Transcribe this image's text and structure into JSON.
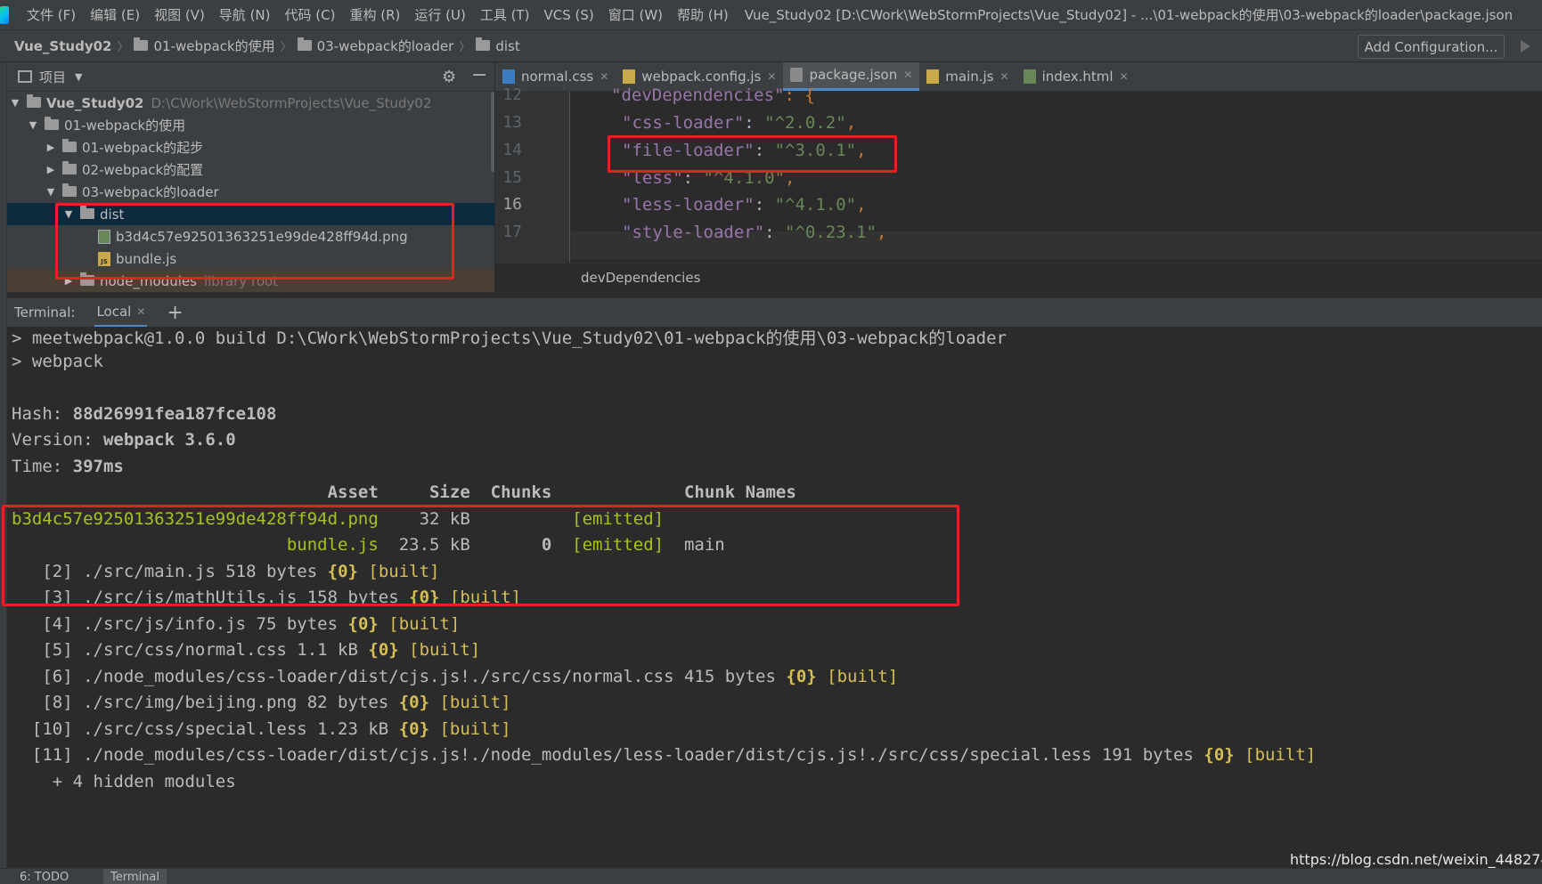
{
  "menubar": {
    "items": [
      "文件 (F)",
      "编辑 (E)",
      "视图 (V)",
      "导航 (N)",
      "代码 (C)",
      "重构 (R)",
      "运行 (U)",
      "工具 (T)",
      "VCS (S)",
      "窗口 (W)",
      "帮助 (H)"
    ],
    "window_title": "Vue_Study02 [D:\\CWork\\WebStormProjects\\Vue_Study02] - ...\\01-webpack的使用\\03-webpack的loader\\package.json"
  },
  "navbar": {
    "crumbs": [
      "Vue_Study02",
      "01-webpack的使用",
      "03-webpack的loader",
      "dist"
    ],
    "add_config": "Add Configuration..."
  },
  "project": {
    "title": "项目",
    "tree": [
      {
        "label": "Vue_Study02",
        "path": "D:\\CWork\\WebStormProjects\\Vue_Study02"
      },
      {
        "label": "01-webpack的使用"
      },
      {
        "label": "01-webpack的起步"
      },
      {
        "label": "02-webpack的配置"
      },
      {
        "label": "03-webpack的loader"
      },
      {
        "label": "dist"
      },
      {
        "label": "b3d4c57e92501363251e99de428ff94d.png"
      },
      {
        "label": "bundle.js"
      },
      {
        "label": "node_modules",
        "extra": "library root"
      }
    ]
  },
  "editor": {
    "tabs": [
      {
        "label": "normal.css",
        "icon": "css-file-icon"
      },
      {
        "label": "webpack.config.js",
        "icon": "js-file-icon"
      },
      {
        "label": "package.json",
        "icon": "json-file-icon"
      },
      {
        "label": "main.js",
        "icon": "js-file-icon"
      },
      {
        "label": "index.html",
        "icon": "html-file-icon"
      }
    ],
    "active_tab": "package.json",
    "lines": [
      {
        "no": "12",
        "key": "\"devDependencies\"",
        "rest": ": {"
      },
      {
        "no": "13",
        "key": "\"css-loader\"",
        "val": "\"^2.0.2\""
      },
      {
        "no": "14",
        "key": "\"file-loader\"",
        "val": "\"^3.0.1\""
      },
      {
        "no": "15",
        "key": "\"less\"",
        "val": "\"^4.1.0\""
      },
      {
        "no": "16",
        "key": "\"less-loader\"",
        "val": "\"^4.1.0\""
      },
      {
        "no": "17",
        "key": "\"style-loader\"",
        "val": "\"^0.23.1\""
      }
    ],
    "breadcrumb": "devDependencies"
  },
  "terminal": {
    "label": "Terminal:",
    "tab": "Local",
    "cmd1": "> meetwebpack@1.0.0 build D:\\CWork\\WebStormProjects\\Vue_Study02\\01-webpack的使用\\03-webpack的loader",
    "cmd2": "> webpack",
    "hash_label": "Hash: ",
    "hash": "88d26991fea187fce108",
    "version_label": "Version: ",
    "version": "webpack 3.6.0",
    "time_label": "Time: ",
    "time": "397ms",
    "table_header": "                               Asset     Size  Chunks             Chunk Names",
    "assets": [
      {
        "name": "b3d4c57e92501363251e99de428ff94d.png",
        "size": "    32 kB",
        "chunk": "          ",
        "status": "[emitted]",
        "names": ""
      },
      {
        "name": "                           bundle.js",
        "size": "  23.5 kB",
        "chunk": "       0  ",
        "status": "[emitted]",
        "names": "  main"
      }
    ],
    "modules": [
      {
        "id": "   [2] ",
        "path": "./src/main.js 518 bytes ",
        "chunk": "{0}",
        "built": " [built]"
      },
      {
        "id": "   [3] ",
        "path": "./src/js/mathUtils.js 158 bytes ",
        "chunk": "{0}",
        "built": " [built]"
      },
      {
        "id": "   [4] ",
        "path": "./src/js/info.js 75 bytes ",
        "chunk": "{0}",
        "built": " [built]"
      },
      {
        "id": "   [5] ",
        "path": "./src/css/normal.css 1.1 kB ",
        "chunk": "{0}",
        "built": " [built]"
      },
      {
        "id": "   [6] ",
        "path": "./node_modules/css-loader/dist/cjs.js!./src/css/normal.css 415 bytes ",
        "chunk": "{0}",
        "built": " [built]"
      },
      {
        "id": "   [8] ",
        "path": "./src/img/beijing.png 82 bytes ",
        "chunk": "{0}",
        "built": " [built]"
      },
      {
        "id": "  [10] ",
        "path": "./src/css/special.less 1.23 kB ",
        "chunk": "{0}",
        "built": " [built]"
      },
      {
        "id": "  [11] ",
        "path": "./node_modules/css-loader/dist/cjs.js!./node_modules/less-loader/dist/cjs.js!./src/css/special.less 191 bytes ",
        "chunk": "{0}",
        "built": " [built]"
      }
    ],
    "hidden": "    + 4 hidden modules"
  },
  "statusbar": {
    "todo": "6: TODO",
    "terminal": "Terminal"
  },
  "watermark": "https://blog.csdn.net/weixin_44827418",
  "colors": {
    "highlight": "#e52222",
    "selection": "#0d293e",
    "accent": "#4a88c7"
  }
}
